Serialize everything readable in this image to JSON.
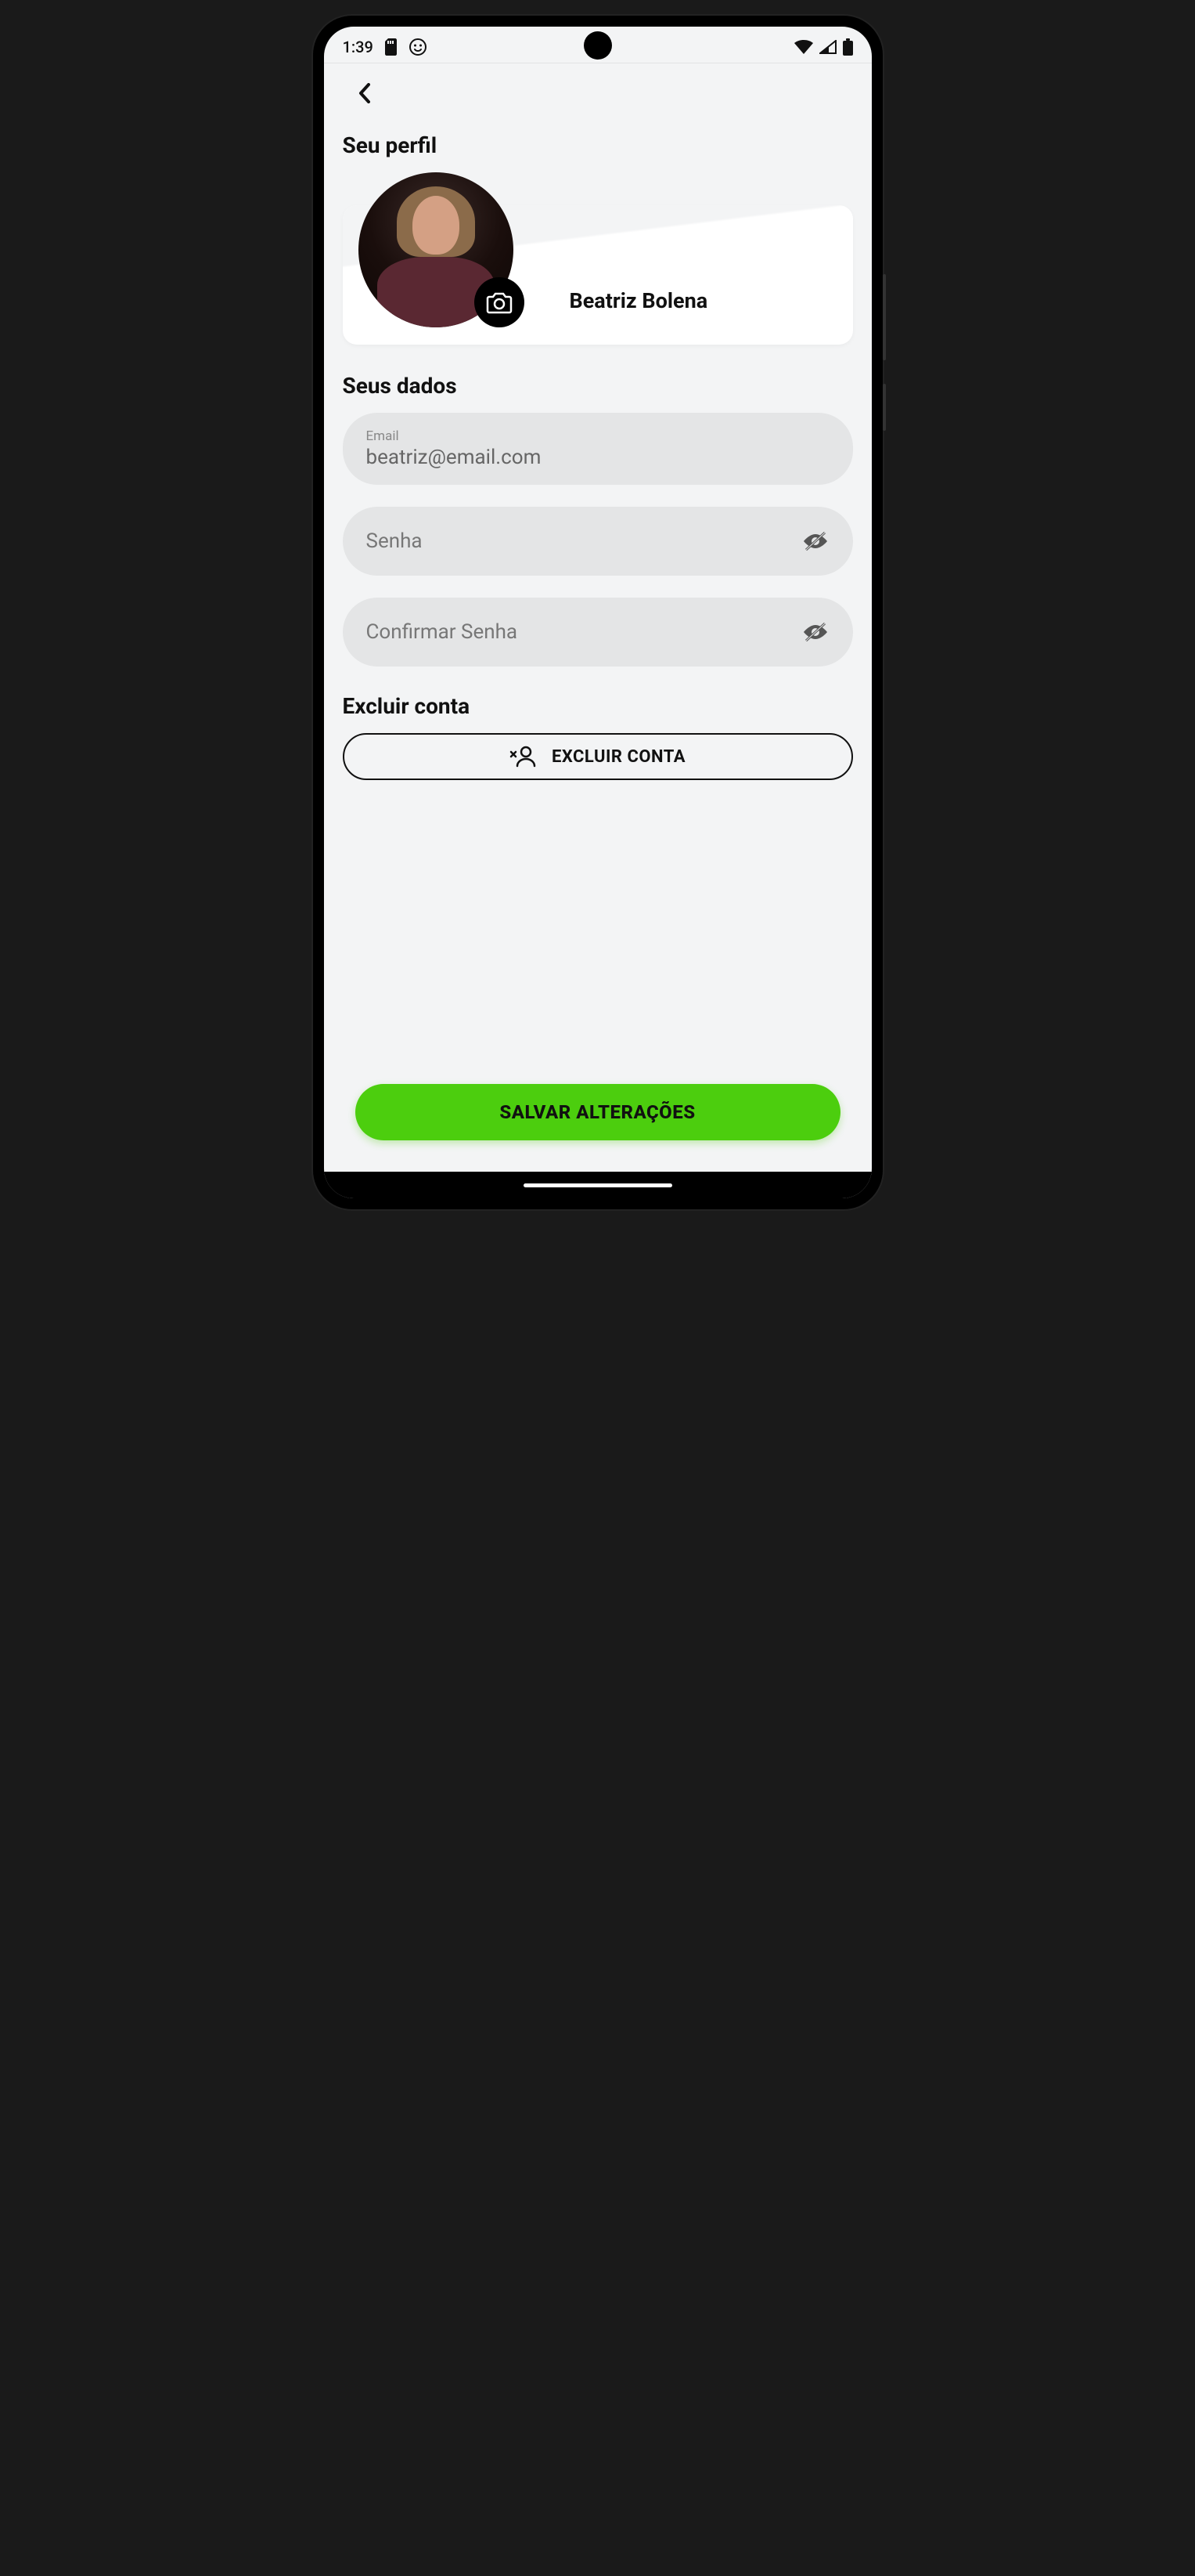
{
  "statusBar": {
    "time": "1:39"
  },
  "header": {
    "profileTitle": "Seu perfil",
    "userName": "Beatriz Bolena"
  },
  "form": {
    "dataTitle": "Seus dados",
    "emailLabel": "Email",
    "emailValue": "beatriz@email.com",
    "passwordPlaceholder": "Senha",
    "confirmPasswordPlaceholder": "Confirmar Senha"
  },
  "delete": {
    "title": "Excluir conta",
    "buttonLabel": "EXCLUIR CONTA"
  },
  "save": {
    "buttonLabel": "SALVAR ALTERAÇÕES"
  }
}
